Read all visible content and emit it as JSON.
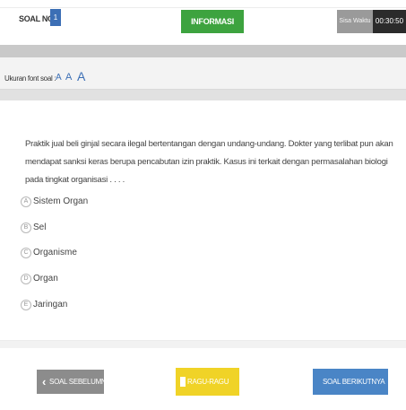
{
  "header": {
    "soal_no_label": "SOAL NO.",
    "soal_number": "1",
    "info_button": "INFORMASI SOAL",
    "sisa_waktu_label": "Sisa Waktu",
    "timer": "00:30:50"
  },
  "font_size": {
    "label": "Ukuran font soal :",
    "options": [
      "A",
      "A",
      "A"
    ]
  },
  "question": {
    "text": "Praktik jual beli ginjal secara ilegal bertentangan dengan undang-undang. Dokter yang terlibat pun akan mendapat sanksi keras berupa pencabutan izin praktik. Kasus ini terkait dengan permasalahan biologi pada tingkat organisasi . . . ."
  },
  "options": [
    {
      "letter": "A",
      "text": "Sistem Organ"
    },
    {
      "letter": "B",
      "text": "Sel"
    },
    {
      "letter": "C",
      "text": "Organisme"
    },
    {
      "letter": "D",
      "text": "Organ"
    },
    {
      "letter": "E",
      "text": "Jaringan"
    }
  ],
  "nav": {
    "prev_label": "SOAL SEBELUMNYA",
    "ragu_label": "RAGU-RAGU",
    "next_label": "SOAL BERIKUTNYA"
  },
  "colors": {
    "info_green": "#3da33f",
    "number_blue": "#3c6fb5",
    "ragu_yellow": "#f0d327",
    "next_blue": "#4a85c6",
    "prev_gray": "#8c8c8c",
    "timer_dark": "#2b2b2b"
  },
  "icons": {
    "prev": "chevron-left-icon",
    "next": "chevron-right-icon",
    "ragu": "checkbox-icon"
  }
}
